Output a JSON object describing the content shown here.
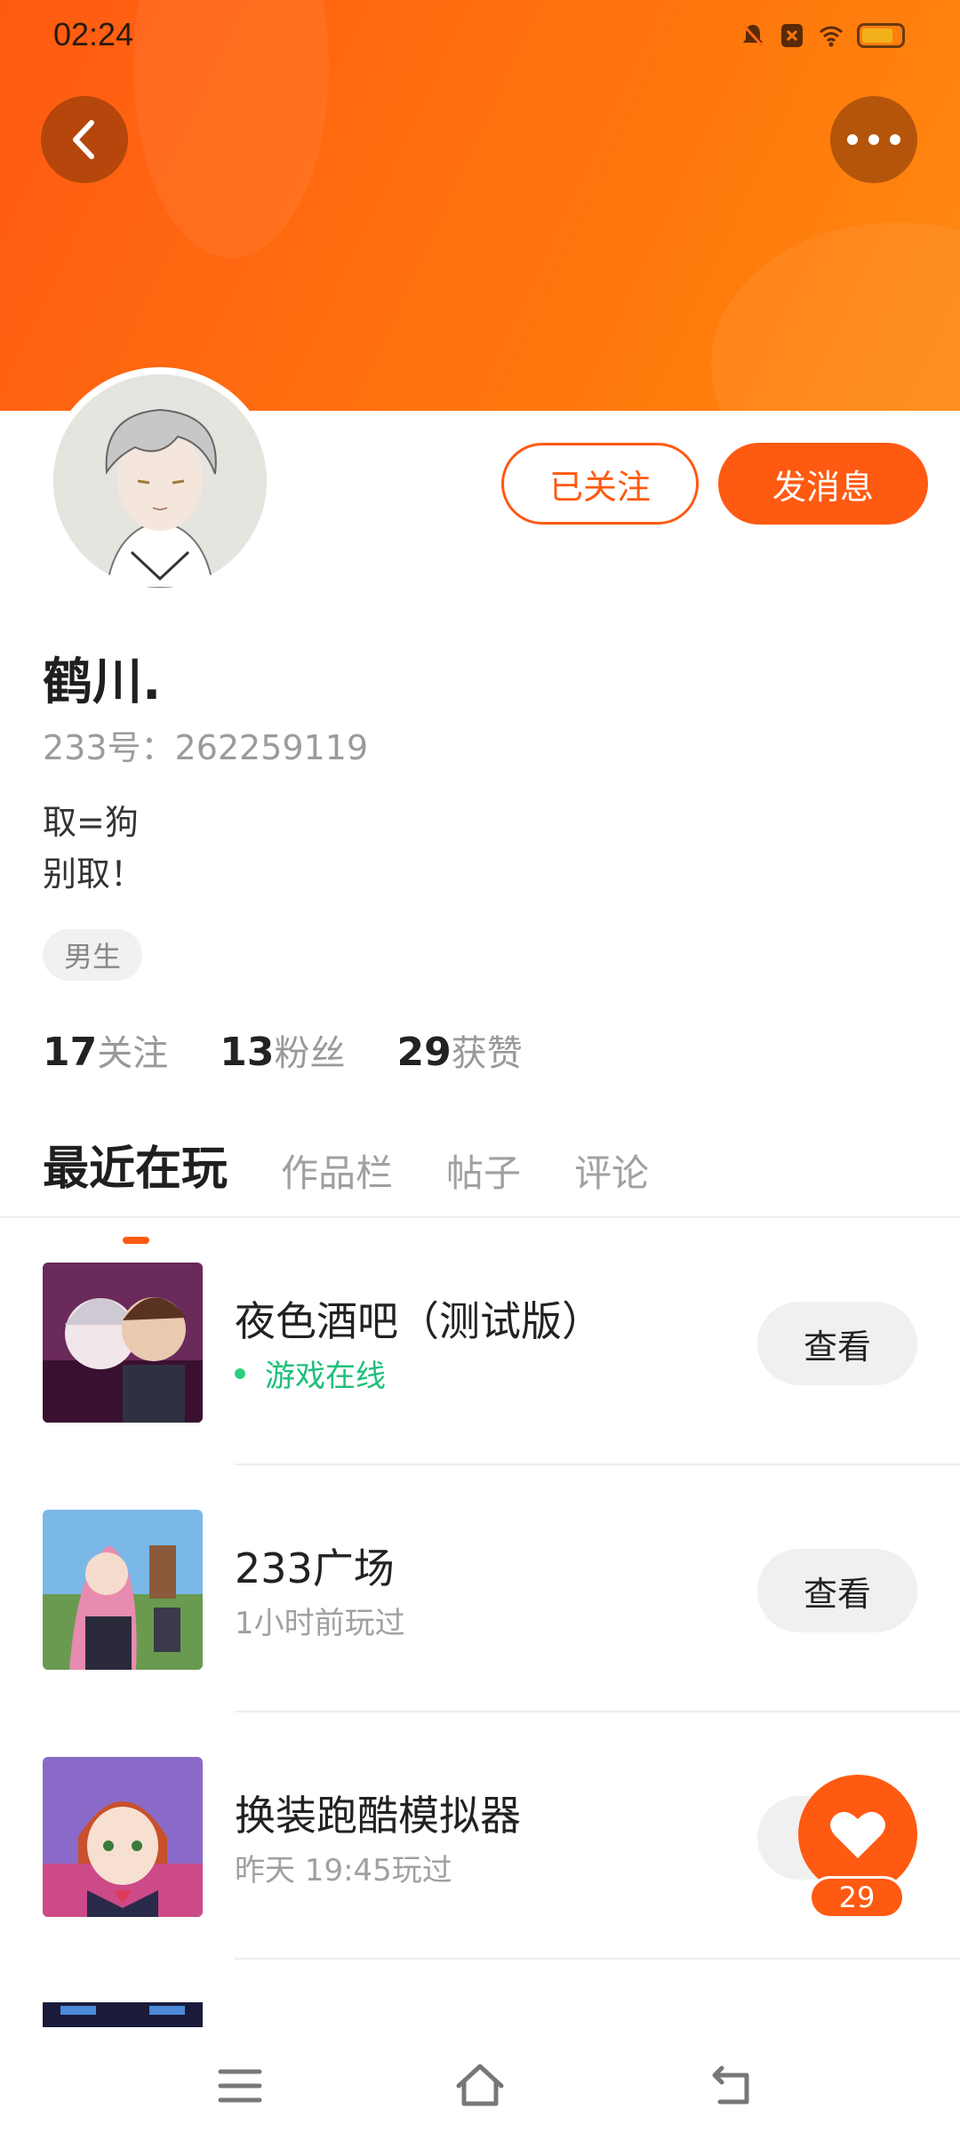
{
  "status_bar": {
    "time": "02:24"
  },
  "profile": {
    "username": "鹤川.",
    "uid_text": "233号：262259119",
    "bio_line1": "取=狗",
    "bio_line2": "别取！",
    "gender": "男生",
    "follow_state_label": "已关注",
    "message_label": "发消息"
  },
  "stats": {
    "following_count": "17",
    "following_label": "关注",
    "followers_count": "13",
    "followers_label": "粉丝",
    "likes_count": "29",
    "likes_label": "获赞"
  },
  "tabs": [
    {
      "label": "最近在玩",
      "active": true
    },
    {
      "label": "作品栏",
      "active": false
    },
    {
      "label": "帖子",
      "active": false
    },
    {
      "label": "评论",
      "active": false
    }
  ],
  "games": [
    {
      "name": "夜色酒吧（测试版）",
      "status": "游戏在线",
      "online": true,
      "button": "查看"
    },
    {
      "name": "233广场",
      "status": "1小时前玩过",
      "online": false,
      "button": "查看"
    },
    {
      "name": "换装跑酷模拟器",
      "status": "昨天  19:45玩过",
      "online": false,
      "button": "查看"
    }
  ],
  "like_fab": {
    "count": "29"
  },
  "colors": {
    "accent": "#ff5a12",
    "online": "#1fbf7a"
  },
  "icons": [
    "back-icon",
    "more-icon",
    "heart-icon",
    "menu-icon",
    "home-icon",
    "back-nav-icon"
  ]
}
